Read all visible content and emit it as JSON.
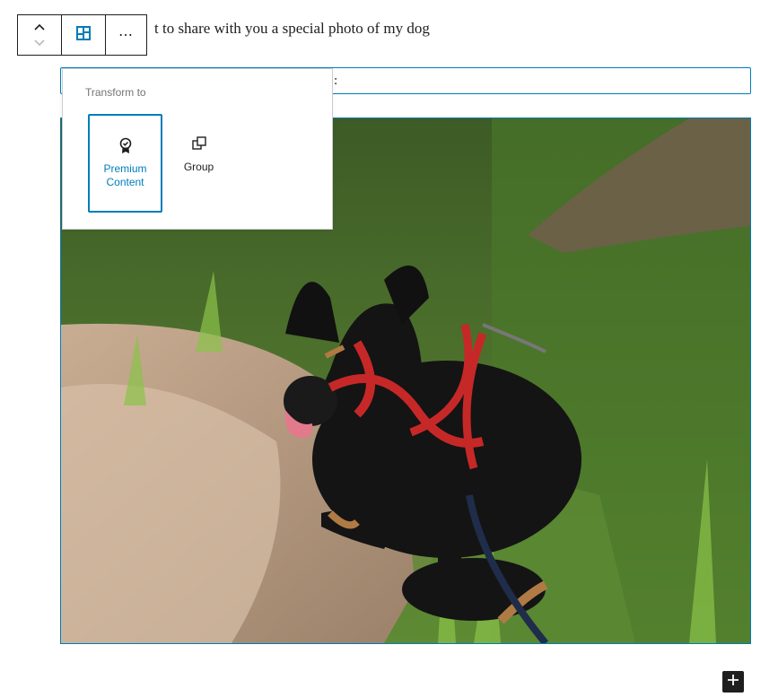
{
  "paragraph_text": "t to share with you a special photo of my dog",
  "row_fragment": ":",
  "toolbar": {
    "move_up_icon": "chevron-up-icon",
    "move_down_icon": "chevron-down-icon",
    "block_icon": "grid-layout-icon",
    "more_label": "⋯"
  },
  "popover": {
    "title": "Transform to",
    "items": [
      {
        "label": "Premium Content",
        "icon": "premium-badge-icon",
        "selected": true
      },
      {
        "label": "Group",
        "icon": "group-icon",
        "selected": false
      }
    ]
  },
  "inserter_icon": "plus-icon",
  "colors": {
    "accent": "#007cba",
    "dark": "#1e1e1e"
  }
}
